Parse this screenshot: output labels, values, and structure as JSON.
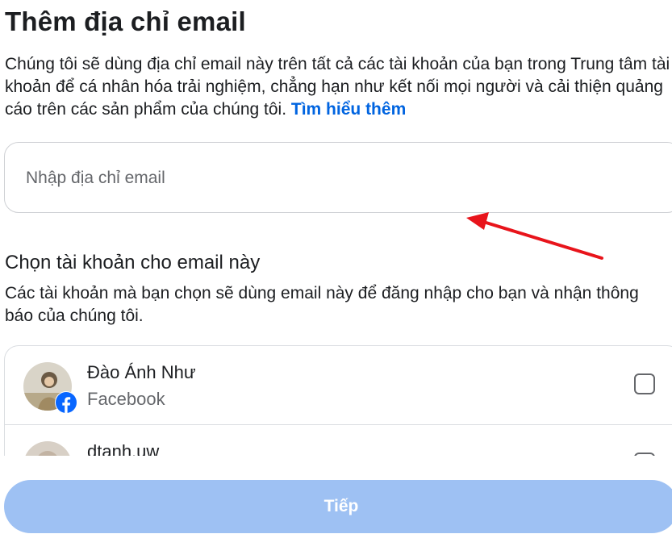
{
  "header": {
    "title": "Thêm địa chỉ email",
    "description": "Chúng tôi sẽ dùng địa chỉ email này trên tất cả các tài khoản của bạn trong Trung tâm tài khoản để cá nhân hóa trải nghiệm, chẳng hạn như kết nối mọi người và cải thiện quảng cáo trên các sản phẩm của chúng tôi.",
    "learn_more": "Tìm hiểu thêm"
  },
  "email_input": {
    "placeholder": "Nhập địa chỉ email",
    "value": ""
  },
  "accounts_section": {
    "title": "Chọn tài khoản cho email này",
    "description": "Các tài khoản mà bạn chọn sẽ dùng email này để đăng nhập cho bạn và nhận thông báo của chúng tôi.",
    "accounts": [
      {
        "name": "Đào Ánh Như",
        "platform": "Facebook",
        "checked": false,
        "icon": "facebook-icon"
      },
      {
        "name": "dtanh.uw",
        "platform": "",
        "checked": false
      }
    ]
  },
  "footer": {
    "next_label": "Tiếp"
  },
  "colors": {
    "link": "#0064e0",
    "button_disabled": "#9ec1f3",
    "annotation_arrow": "#e8141b",
    "facebook_blue": "#0866ff"
  }
}
